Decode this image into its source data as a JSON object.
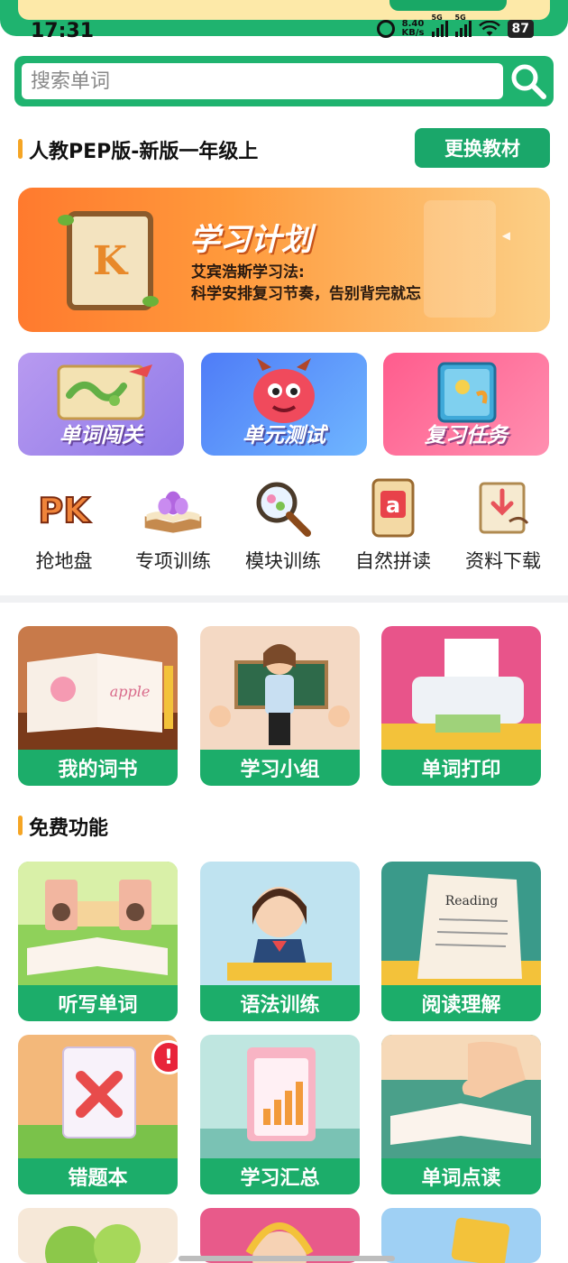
{
  "status_bar": {
    "time": "17:31",
    "net_speed_value": "8.40",
    "net_speed_unit": "KB/s",
    "signal_1": "5G",
    "signal_2": "5G",
    "battery": "87"
  },
  "search": {
    "placeholder": "搜索单词"
  },
  "textbook": {
    "title": "人教PEP版-新版一年级上",
    "change_label": "更换教材"
  },
  "study_plan": {
    "title": "学习计划",
    "subtitle_line1": "艾宾浩斯学习法:",
    "subtitle_line2": "科学安排复习节奏，告别背完就忘",
    "badge_letter": "K"
  },
  "main_features": [
    {
      "label": "单词闯关"
    },
    {
      "label": "单元测试"
    },
    {
      "label": "复习任务"
    }
  ],
  "icon_grid": [
    {
      "label": "抢地盘",
      "icon": "pk-icon",
      "glyph": "PK"
    },
    {
      "label": "专项训练",
      "icon": "book-flower-icon"
    },
    {
      "label": "模块训练",
      "icon": "magnifier-icon"
    },
    {
      "label": "自然拼读",
      "icon": "letter-card-icon",
      "glyph": "a"
    },
    {
      "label": "资料下载",
      "icon": "download-scroll-icon"
    }
  ],
  "tiles_top": [
    {
      "label": "我的词书",
      "pic_text": "apple"
    },
    {
      "label": "学习小组"
    },
    {
      "label": "单词打印"
    }
  ],
  "free_section": {
    "title": "免费功能"
  },
  "tiles_free_row1": [
    {
      "label": "听写单词"
    },
    {
      "label": "语法训练"
    },
    {
      "label": "阅读理解",
      "pic_text": "Reading"
    }
  ],
  "tiles_free_row2": [
    {
      "label": "错题本",
      "badge": "!"
    },
    {
      "label": "学习汇总"
    },
    {
      "label": "单词点读"
    }
  ],
  "colors": {
    "brand_green": "#1cad6a",
    "accent_orange": "#f5a524",
    "alert_red": "#e8243a"
  }
}
